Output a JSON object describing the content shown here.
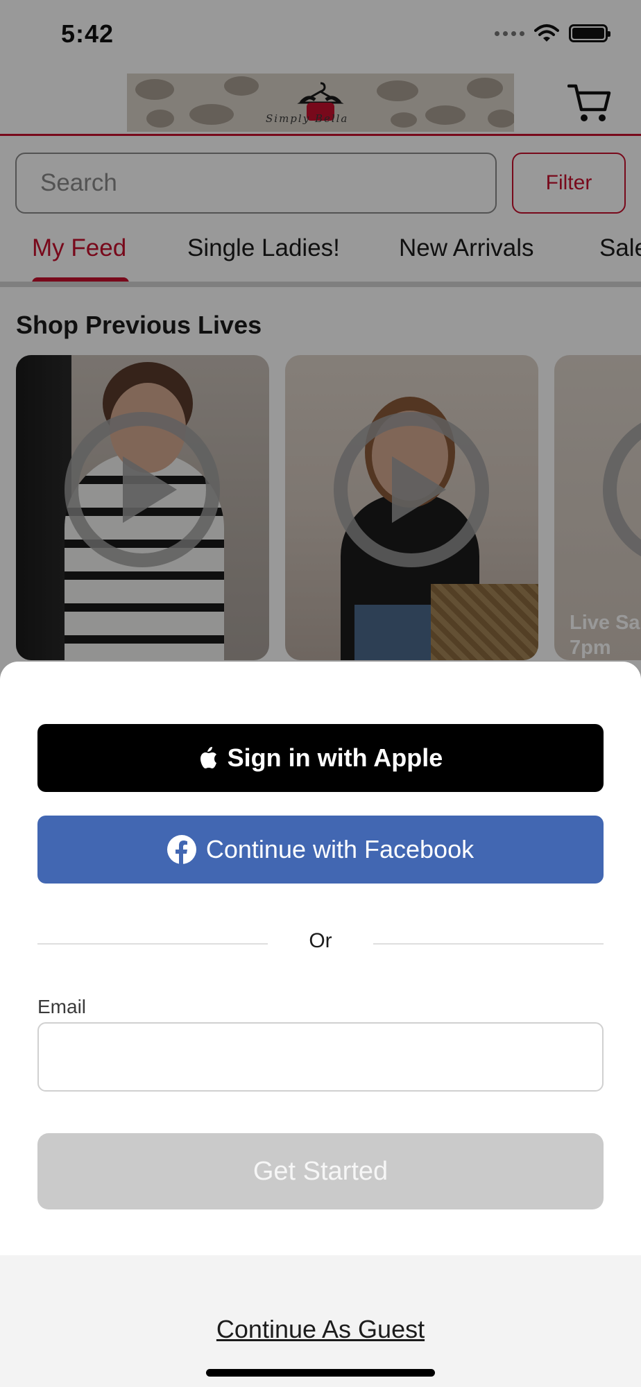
{
  "status_bar": {
    "time": "5:42"
  },
  "header": {
    "logo_text": "Simply Bella"
  },
  "search": {
    "placeholder": "Search",
    "filter_label": "Filter"
  },
  "tabs": [
    {
      "label": "My Feed",
      "active": true
    },
    {
      "label": "Single Ladies!",
      "active": false
    },
    {
      "label": "New Arrivals",
      "active": false
    },
    {
      "label": "Sale",
      "active": false
    }
  ],
  "section": {
    "title": "Shop Previous Lives"
  },
  "cards": [
    {
      "caption": ""
    },
    {
      "caption": ""
    },
    {
      "caption_line1": "Live Sa",
      "caption_line2": "7pm"
    }
  ],
  "sheet": {
    "apple_label": "Sign in with Apple",
    "facebook_label": "Continue with Facebook",
    "or_label": "Or",
    "email_label": "Email",
    "email_value": "",
    "get_started_label": "Get Started",
    "guest_label": "Continue As Guest"
  },
  "colors": {
    "accent": "#c8102e",
    "facebook": "#4267b2",
    "apple": "#000000",
    "disabled_button": "#cacaca"
  },
  "icons": [
    "apple-icon",
    "facebook-icon",
    "cart-icon",
    "wifi-icon",
    "battery-icon",
    "signal-icon",
    "play-icon"
  ]
}
